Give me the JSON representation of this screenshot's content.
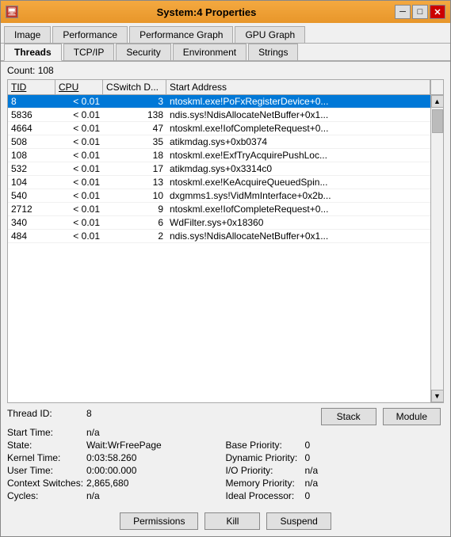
{
  "window": {
    "title": "System:4 Properties",
    "icon": "📋"
  },
  "titlebar": {
    "minimize": "─",
    "restore": "□",
    "close": "✕"
  },
  "tabs_row1": [
    {
      "label": "Image",
      "active": false
    },
    {
      "label": "Performance",
      "active": false
    },
    {
      "label": "Performance Graph",
      "active": false
    },
    {
      "label": "GPU Graph",
      "active": false
    }
  ],
  "tabs_row2": [
    {
      "label": "Threads",
      "active": true
    },
    {
      "label": "TCP/IP",
      "active": false
    },
    {
      "label": "Security",
      "active": false
    },
    {
      "label": "Environment",
      "active": false
    },
    {
      "label": "Strings",
      "active": false
    }
  ],
  "count": {
    "label": "Count:",
    "value": "108"
  },
  "table": {
    "columns": [
      "TID",
      "CPU",
      "CSwitch D...",
      "Start Address"
    ],
    "rows": [
      {
        "tid": "8",
        "cpu": "< 0.01",
        "cswitch": "3",
        "address": "ntoskml.exe!PoFxRegisterDevice+0...",
        "selected": true
      },
      {
        "tid": "5836",
        "cpu": "< 0.01",
        "cswitch": "138",
        "address": "ndis.sys!NdisAllocateNetBuffer+0x1...",
        "selected": false
      },
      {
        "tid": "4664",
        "cpu": "< 0.01",
        "cswitch": "47",
        "address": "ntoskml.exe!IofCompleteRequest+0...",
        "selected": false
      },
      {
        "tid": "508",
        "cpu": "< 0.01",
        "cswitch": "35",
        "address": "atikmdag.sys+0xb0374",
        "selected": false
      },
      {
        "tid": "108",
        "cpu": "< 0.01",
        "cswitch": "18",
        "address": "ntoskml.exe!ExfTryAcquirePushLoc...",
        "selected": false
      },
      {
        "tid": "532",
        "cpu": "< 0.01",
        "cswitch": "17",
        "address": "atikmdag.sys+0x3314c0",
        "selected": false
      },
      {
        "tid": "104",
        "cpu": "< 0.01",
        "cswitch": "13",
        "address": "ntoskml.exe!KeAcquireQueuedSpin...",
        "selected": false
      },
      {
        "tid": "540",
        "cpu": "< 0.01",
        "cswitch": "10",
        "address": "dxgmms1.sys!VidMmInterface+0x2b...",
        "selected": false
      },
      {
        "tid": "2712",
        "cpu": "< 0.01",
        "cswitch": "9",
        "address": "ntoskml.exe!IofCompleteRequest+0...",
        "selected": false
      },
      {
        "tid": "340",
        "cpu": "< 0.01",
        "cswitch": "6",
        "address": "WdFilter.sys+0x18360",
        "selected": false
      },
      {
        "tid": "484",
        "cpu": "< 0.01",
        "cswitch": "2",
        "address": "ndis.sys!NdisAllocateNetBuffer+0x1...",
        "selected": false
      }
    ]
  },
  "details": {
    "thread_id_label": "Thread ID:",
    "thread_id_value": "8",
    "start_time_label": "Start Time:",
    "start_time_value": "n/a",
    "state_label": "State:",
    "state_value": "Wait:WrFreePage",
    "base_priority_label": "Base Priority:",
    "base_priority_value": "0",
    "kernel_time_label": "Kernel Time:",
    "kernel_time_value": "0:03:58.260",
    "dynamic_priority_label": "Dynamic Priority:",
    "dynamic_priority_value": "0",
    "user_time_label": "User Time:",
    "user_time_value": "0:00:00.000",
    "io_priority_label": "I/O Priority:",
    "io_priority_value": "n/a",
    "context_switches_label": "Context Switches:",
    "context_switches_value": "2,865,680",
    "memory_priority_label": "Memory Priority:",
    "memory_priority_value": "n/a",
    "cycles_label": "Cycles:",
    "cycles_value": "n/a",
    "ideal_processor_label": "Ideal Processor:",
    "ideal_processor_value": "0"
  },
  "buttons": {
    "stack": "Stack",
    "module": "Module",
    "permissions": "Permissions",
    "kill": "Kill",
    "suspend": "Suspend"
  }
}
